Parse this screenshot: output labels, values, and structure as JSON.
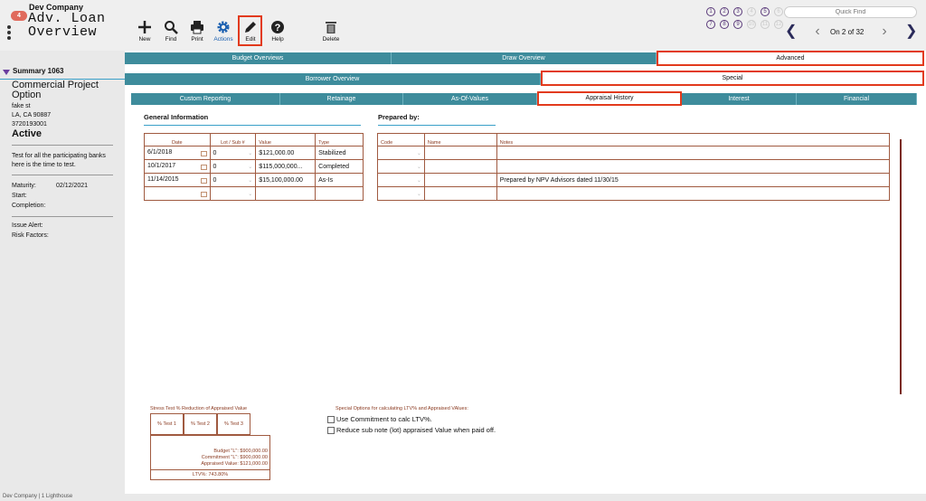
{
  "header": {
    "company": "Dev Company",
    "badge_count": "4",
    "title_line1": "Adv. Loan",
    "title_line2": "Overview",
    "toolbar": {
      "new": "New",
      "find": "Find",
      "print": "Print",
      "actions": "Actions",
      "edit": "Edit",
      "help": "Help",
      "delete": "Delete"
    },
    "quickfind_placeholder": "Quick Find",
    "nav_numbers": [
      "1",
      "2",
      "3",
      "4",
      "5",
      "6",
      "7",
      "8",
      "9",
      "10",
      "11",
      "12"
    ],
    "page_count": "On 2 of 32"
  },
  "sidebar": {
    "summary": "Summary 1063",
    "project": "Commercial Project Option",
    "address1": "fake st",
    "address2": "LA, CA  90887",
    "loan_number": "3720193001",
    "status": "Active",
    "note": "Test for all the participating banks here is the time to test.",
    "maturity_label": "Maturity:",
    "maturity_value": "02/12/2021",
    "start_label": "Start:",
    "completion_label": "Completion:",
    "issue_alert_label": "Issue Alert:",
    "risk_factors_label": "Risk Factors:"
  },
  "tabs": {
    "row1": [
      "Budget Overviews",
      "Draw Overview",
      "Advanced"
    ],
    "row2": [
      "Borrower Overview",
      "Special"
    ],
    "row3": [
      "Custom Reporting",
      "Retainage",
      "As-Of-Values",
      "Appraisal History",
      "Interest",
      "Financial"
    ]
  },
  "general": {
    "title": "General Information",
    "columns": [
      "Date",
      "Lot / Sub #",
      "Value",
      "Type"
    ],
    "rows": [
      {
        "date": "6/1/2018",
        "lot": "0",
        "value": "$121,000.00",
        "type": "Stabilized"
      },
      {
        "date": "10/1/2017",
        "lot": "0",
        "value": "$115,000,000...",
        "type": "Completed"
      },
      {
        "date": "11/14/2015",
        "lot": "0",
        "value": "$15,100,000.00",
        "type": "As-Is"
      },
      {
        "date": "",
        "lot": "",
        "value": "",
        "type": ""
      }
    ]
  },
  "prepared": {
    "title": "Prepared by:",
    "columns": [
      "Code",
      "Name",
      "Notes"
    ],
    "rows": [
      {
        "code": "",
        "name": "",
        "notes": ""
      },
      {
        "code": "",
        "name": "",
        "notes": ""
      },
      {
        "code": "",
        "name": "",
        "notes": "Prepared by NPV Advisors dated 11/30/15"
      },
      {
        "code": "",
        "name": "",
        "notes": ""
      }
    ]
  },
  "stress": {
    "title": "Stress Test % Reduction of Appraised Value",
    "tests": [
      "% Test 1",
      "% Test 2",
      "% Test 3"
    ],
    "budget": "Budget \"L\":   $900,000.00",
    "commitment": "Commitment \"L\":   $900,000.00",
    "appraised": "Appraised Value:   $121,000.00",
    "ltv": "LTV%:   743.80%"
  },
  "special_options": {
    "title": "Special Options for calculating LTV% and Appraised VAlues:",
    "opt1": "Use Commitment to calc LTV%.",
    "opt2": "Reduce sub note (lot) appraised Value when paid off."
  },
  "footer": "Dev Company | 1 Lighthouse"
}
